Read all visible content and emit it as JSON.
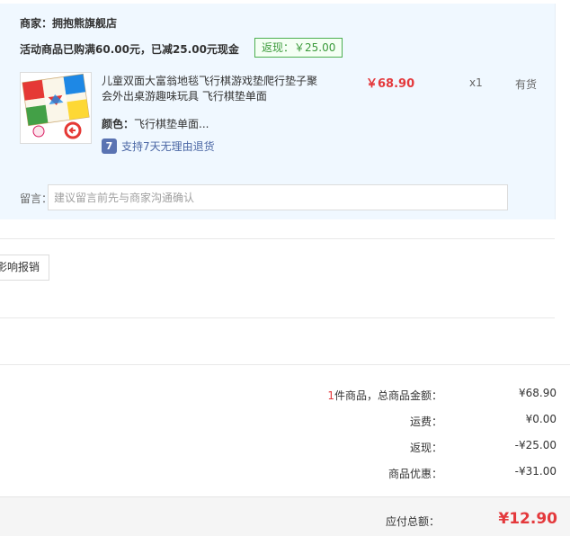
{
  "shop": {
    "merchant_label": "商家：拥抱熊旗舰店",
    "promo_text": "活动商品已购满60.00元，已减25.00元现金",
    "rebate_tag": "返现：￥25.00"
  },
  "item": {
    "title": "儿童双面大富翁地毯飞行棋游戏垫爬行垫子聚会外出桌游趣味玩具 飞行棋垫单面",
    "price": "￥68.90",
    "quantity": "x1",
    "stock": "有货",
    "spec_label": "颜色：",
    "spec_value": "飞行棋垫单面...",
    "return_icon_text": "7",
    "return_text": "支持7天无理由退货"
  },
  "message": {
    "label": "留言：",
    "placeholder": "建议留言前先与商家沟通确认"
  },
  "side_button": "影响报销",
  "summary": {
    "count": "1",
    "goods_label": "件商品，总商品金额：",
    "goods_value": "¥68.90",
    "shipping_label": "运费：",
    "shipping_value": "¥0.00",
    "cashback_label": "返现：",
    "cashback_value": "-¥25.00",
    "discount_label": "商品优惠：",
    "discount_value": "-¥31.00",
    "total_label": "应付总额：",
    "total_value": "¥12.90"
  },
  "colors": {
    "accent_red": "#e4393c",
    "panel_bg": "#f0f8ff",
    "rebate_green": "#4caf50"
  }
}
